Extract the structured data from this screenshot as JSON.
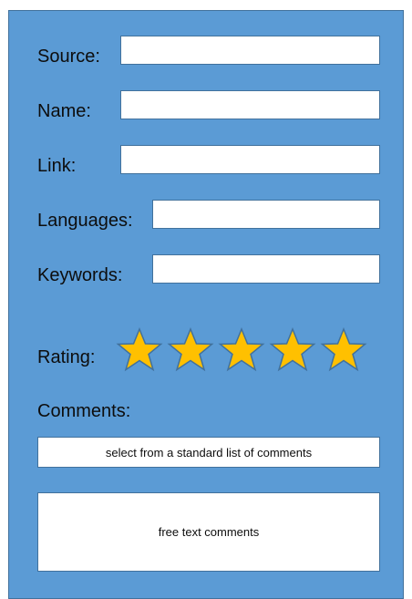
{
  "form": {
    "source_label": "Source:",
    "source_value": "",
    "name_label": "Name:",
    "name_value": "",
    "link_label": "Link:",
    "link_value": "",
    "languages_label": "Languages:",
    "languages_value": "",
    "keywords_label": "Keywords:",
    "keywords_value": "",
    "rating_label": "Rating:",
    "rating": {
      "stars_shown": 5,
      "star_icon": "star-icon",
      "star_fill": "#ffc000",
      "star_stroke": "#41719c"
    },
    "comments_label": "Comments:",
    "comments_select_text": "select from a standard list of comments",
    "comments_free_text": "free text comments"
  },
  "colors": {
    "panel_background": "#5b9bd5",
    "panel_border": "#41719c",
    "field_background": "#ffffff"
  }
}
